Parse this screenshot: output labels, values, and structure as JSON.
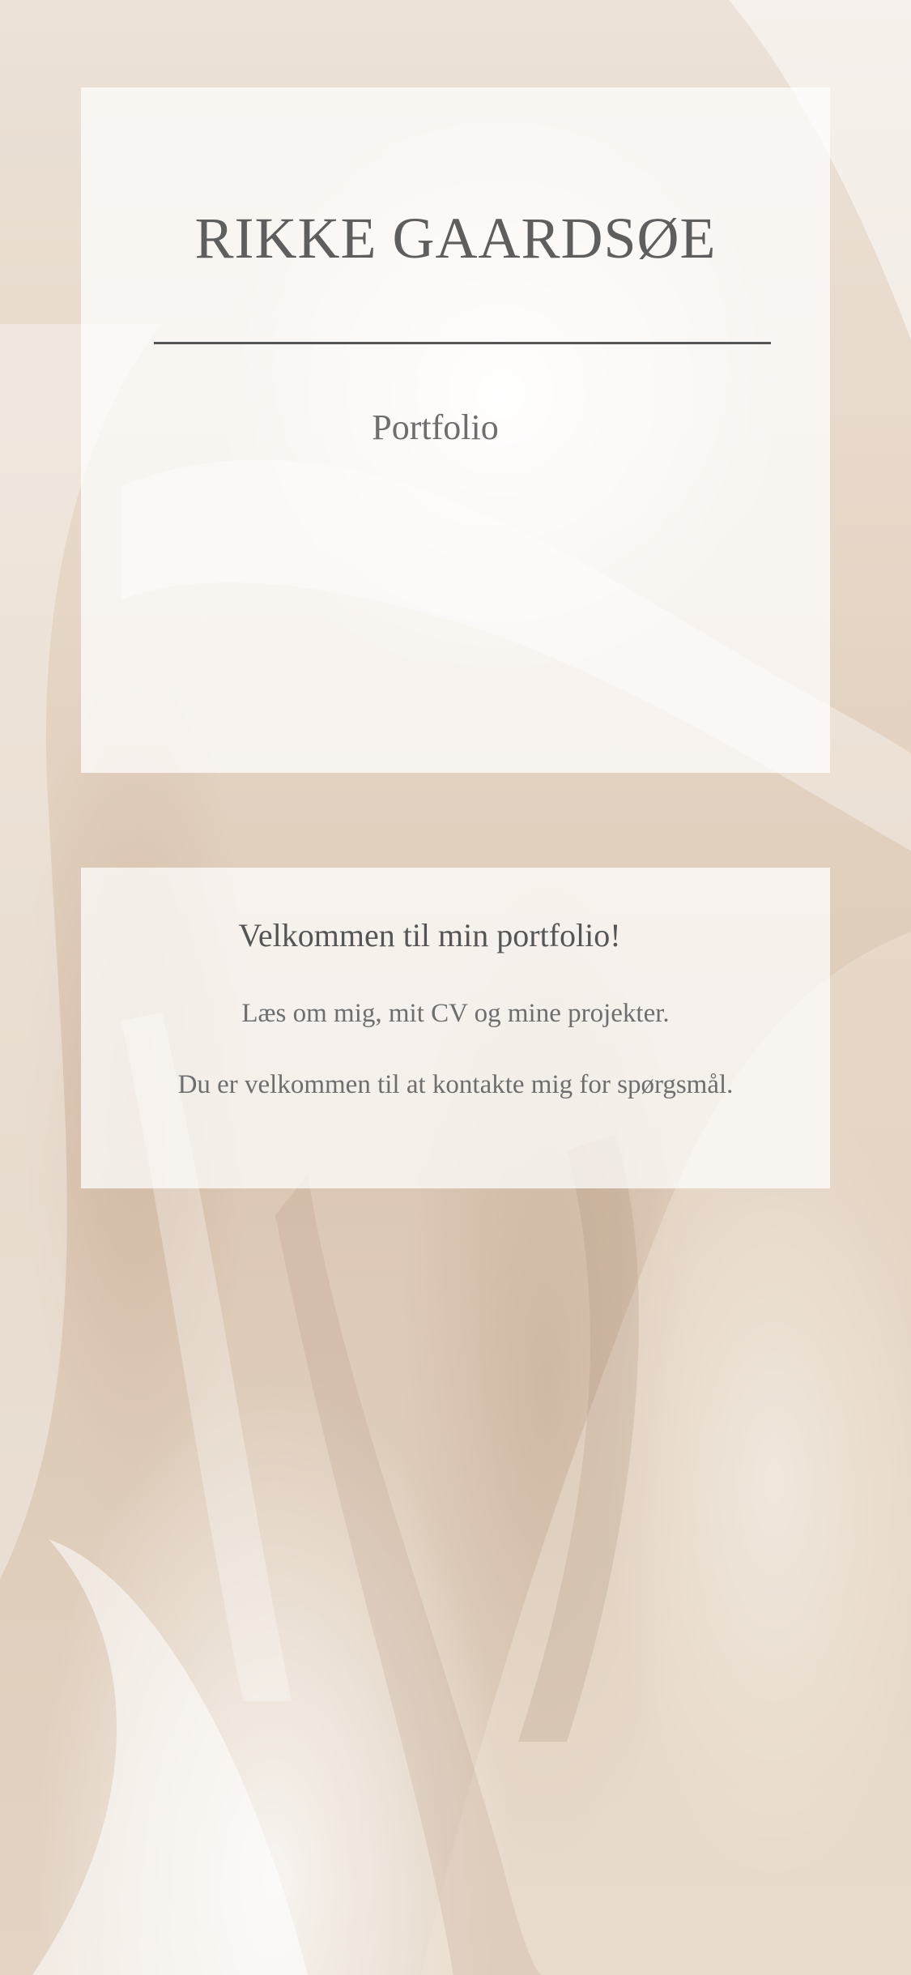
{
  "header": {
    "name": "RIKKE GAARDSØE",
    "subtitle": "Portfolio"
  },
  "welcome": {
    "heading": "Velkommen til min portfolio!",
    "line1": "Læs om mig, mit CV og mine projekter.",
    "line2": "Du er velkommen til at kontakte mig for spørgsmål."
  },
  "colors": {
    "text": "#6a6a6a",
    "rule": "#555555",
    "background": "#e6d6c6"
  }
}
